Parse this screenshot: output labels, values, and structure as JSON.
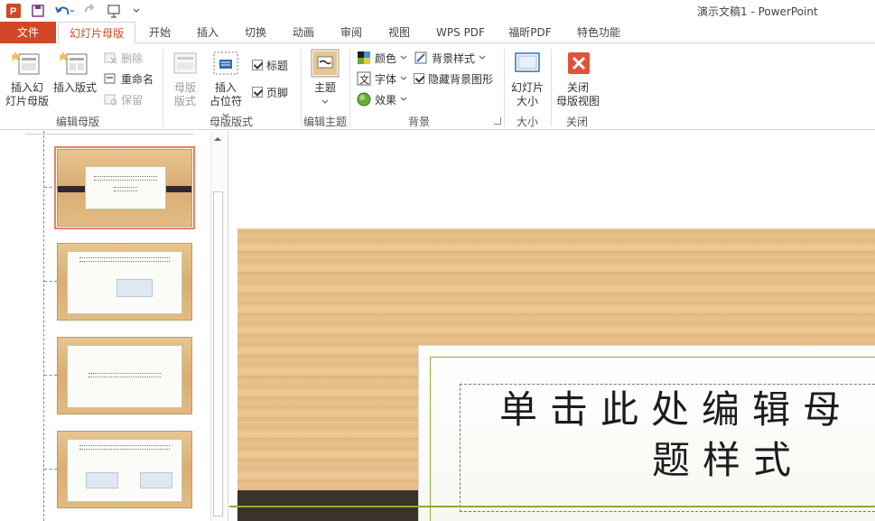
{
  "window": {
    "title": "演示文稿1 - PowerPoint"
  },
  "tabs": [
    {
      "label": "文件"
    },
    {
      "label": "幻灯片母版"
    },
    {
      "label": "开始"
    },
    {
      "label": "插入"
    },
    {
      "label": "切换"
    },
    {
      "label": "动画"
    },
    {
      "label": "审阅"
    },
    {
      "label": "视图"
    },
    {
      "label": "WPS PDF"
    },
    {
      "label": "福昕PDF"
    },
    {
      "label": "特色功能"
    }
  ],
  "ribbon": {
    "edit_master": {
      "label": "编辑母版",
      "insert_master_l1": "插入幻",
      "insert_master_l2": "灯片母版",
      "insert_layout": "插入版式",
      "delete": "删除",
      "rename": "重命名",
      "preserve": "保留"
    },
    "master_layout": {
      "label": "母版版式",
      "master_layout_l1": "母版",
      "master_layout_l2": "版式",
      "insert_placeholder_l1": "插入",
      "insert_placeholder_l2": "占位符",
      "title_check": "标题",
      "footer_check": "页脚"
    },
    "edit_theme": {
      "label": "编辑主题",
      "theme": "主题"
    },
    "background": {
      "label": "背景",
      "colors": "颜色",
      "fonts": "字体",
      "effects": "效果",
      "bg_styles": "背景样式",
      "hide_bg": "隐藏背景图形"
    },
    "size": {
      "label": "大小",
      "slide_size_l1": "幻灯片",
      "slide_size_l2": "大小"
    },
    "close": {
      "label": "关闭",
      "close_l1": "关闭",
      "close_l2": "母版视图"
    }
  },
  "slide": {
    "title_line1": "单击此处编辑母",
    "title_line2": "题样式"
  },
  "colors": {
    "accent": "#d24726",
    "selected_thumb": "#e8815f",
    "frame_green": "#8bad3a"
  }
}
